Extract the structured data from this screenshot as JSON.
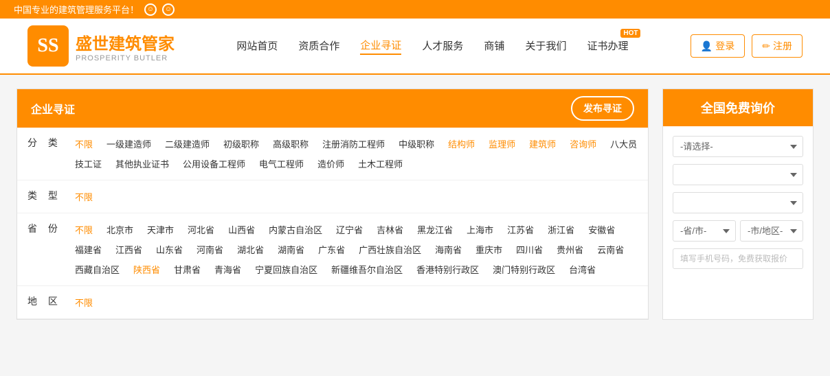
{
  "topBanner": {
    "text": "中国专业的建筑管理服务平台！"
  },
  "header": {
    "logoIconText": "SS",
    "logoChineseName1": "盛世",
    "logoChineseName2": "建筑",
    "logoChineseName3": "管家",
    "logoEnglish": "PROSPERITY BUTLER",
    "nav": [
      {
        "id": "home",
        "label": "网站首页",
        "active": false
      },
      {
        "id": "qualification",
        "label": "资质合作",
        "active": false
      },
      {
        "id": "enterprise",
        "label": "企业寻证",
        "active": true
      },
      {
        "id": "talent",
        "label": "人才服务",
        "active": false
      },
      {
        "id": "shop",
        "label": "商铺",
        "active": false
      },
      {
        "id": "about",
        "label": "关于我们",
        "active": false
      },
      {
        "id": "certificate",
        "label": "证书办理",
        "active": false,
        "hot": true
      }
    ],
    "loginLabel": "登录",
    "registerLabel": "注册"
  },
  "leftPanel": {
    "title": "企业寻证",
    "publishBtn": "发布寻证",
    "filters": [
      {
        "id": "category",
        "label": "分  类",
        "tags": [
          {
            "id": "nolimit",
            "text": "不限",
            "active": true
          },
          {
            "id": "t1",
            "text": "一级建造师",
            "active": false
          },
          {
            "id": "t2",
            "text": "二级建造师",
            "active": false
          },
          {
            "id": "t3",
            "text": "初级职称",
            "active": false
          },
          {
            "id": "t4",
            "text": "高级职称",
            "active": false
          },
          {
            "id": "t5",
            "text": "注册消防工程师",
            "active": false
          },
          {
            "id": "t6",
            "text": "中级职称",
            "active": false
          },
          {
            "id": "t7",
            "text": "结构师",
            "active": false,
            "highlight": true
          },
          {
            "id": "t8",
            "text": "监理师",
            "active": false,
            "highlight": true
          },
          {
            "id": "t9",
            "text": "建筑师",
            "active": false,
            "highlight": true
          },
          {
            "id": "t10",
            "text": "咨询师",
            "active": false,
            "highlight": true
          },
          {
            "id": "t11",
            "text": "八大员",
            "active": false
          },
          {
            "id": "t12",
            "text": "技工证",
            "active": false
          },
          {
            "id": "t13",
            "text": "其他执业证书",
            "active": false
          },
          {
            "id": "t14",
            "text": "公用设备工程师",
            "active": false
          },
          {
            "id": "t15",
            "text": "电气工程师",
            "active": false
          },
          {
            "id": "t16",
            "text": "造价师",
            "active": false
          },
          {
            "id": "t17",
            "text": "土木工程师",
            "active": false
          }
        ]
      },
      {
        "id": "type",
        "label": "类  型",
        "tags": [
          {
            "id": "nolimit",
            "text": "不限",
            "active": true
          }
        ]
      },
      {
        "id": "province",
        "label": "省  份",
        "tags": [
          {
            "id": "nolimit",
            "text": "不限",
            "active": true
          },
          {
            "id": "beijing",
            "text": "北京市",
            "active": false
          },
          {
            "id": "tianjin",
            "text": "天津市",
            "active": false
          },
          {
            "id": "hebei",
            "text": "河北省",
            "active": false
          },
          {
            "id": "shanxi",
            "text": "山西省",
            "active": false
          },
          {
            "id": "neimenggu",
            "text": "内蒙古自治区",
            "active": false
          },
          {
            "id": "liaoning",
            "text": "辽宁省",
            "active": false
          },
          {
            "id": "jilin",
            "text": "吉林省",
            "active": false
          },
          {
            "id": "heilongjiang",
            "text": "黑龙江省",
            "active": false
          },
          {
            "id": "shanghai",
            "text": "上海市",
            "active": false
          },
          {
            "id": "jiangsu",
            "text": "江苏省",
            "active": false
          },
          {
            "id": "zhejiang",
            "text": "浙江省",
            "active": false
          },
          {
            "id": "anhui",
            "text": "安徽省",
            "active": false
          },
          {
            "id": "fujian",
            "text": "福建省",
            "active": false
          },
          {
            "id": "jiangxi",
            "text": "江西省",
            "active": false
          },
          {
            "id": "shandong",
            "text": "山东省",
            "active": false
          },
          {
            "id": "henan",
            "text": "河南省",
            "active": false
          },
          {
            "id": "hubei",
            "text": "湖北省",
            "active": false
          },
          {
            "id": "hunan",
            "text": "湖南省",
            "active": false
          },
          {
            "id": "guangdong",
            "text": "广东省",
            "active": false
          },
          {
            "id": "guangxi",
            "text": "广西壮族自治区",
            "active": false
          },
          {
            "id": "hainan",
            "text": "海南省",
            "active": false
          },
          {
            "id": "chongqing",
            "text": "重庆市",
            "active": false
          },
          {
            "id": "sichuan",
            "text": "四川省",
            "active": false
          },
          {
            "id": "guizhou",
            "text": "贵州省",
            "active": false
          },
          {
            "id": "yunnan",
            "text": "云南省",
            "active": false
          },
          {
            "id": "xizang",
            "text": "西藏自治区",
            "active": false
          },
          {
            "id": "shaanxi",
            "text": "陕西省",
            "active": false,
            "highlight": true
          },
          {
            "id": "gansu",
            "text": "甘肃省",
            "active": false
          },
          {
            "id": "qinghai",
            "text": "青海省",
            "active": false
          },
          {
            "id": "ningxia",
            "text": "宁夏回族自治区",
            "active": false
          },
          {
            "id": "xinjiang",
            "text": "新疆维吾尔自治区",
            "active": false
          },
          {
            "id": "xianggang",
            "text": "香港特别行政区",
            "active": false
          },
          {
            "id": "aomen",
            "text": "澳门特别行政区",
            "active": false
          },
          {
            "id": "taiwan",
            "text": "台湾省",
            "active": false
          }
        ]
      },
      {
        "id": "region",
        "label": "地  区",
        "tags": [
          {
            "id": "nolimit",
            "text": "不限",
            "active": true
          }
        ]
      }
    ]
  },
  "rightPanel": {
    "title": "全国免费询价",
    "select1Placeholder": "-请选择-",
    "select2Placeholder": "",
    "select3Placeholder": "",
    "provinceLabel": "-省/市-",
    "cityLabel": "-市/地区-",
    "phonePlaceholder": "填写手机号码，免费获取报价"
  }
}
